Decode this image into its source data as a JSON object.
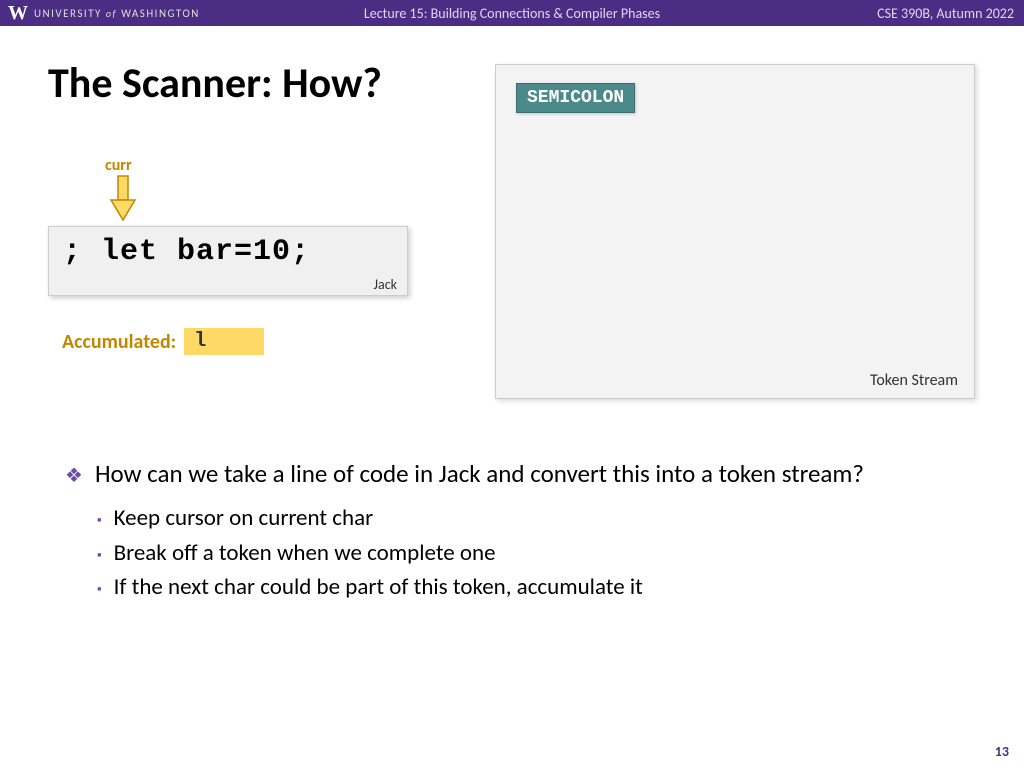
{
  "header": {
    "university_prefix": "UNIVERSITY",
    "university_of": "of",
    "university_name": "WASHINGTON",
    "lecture": "Lecture 15: Building Connections & Compiler Phases",
    "course": "CSE 390B, Autumn 2022"
  },
  "title": "The Scanner: How?",
  "cursor": {
    "label": "curr"
  },
  "code": {
    "text": "; let bar=10;",
    "language": "Jack"
  },
  "accumulated": {
    "label": "Accumulated:",
    "value": "l"
  },
  "token_stream": {
    "tokens": [
      "SEMICOLON"
    ],
    "label": "Token Stream"
  },
  "bullets": {
    "main": "How can we take a line of code in Jack and convert this into a token stream?",
    "subs": [
      "Keep cursor on current char",
      "Break off a token when we complete one",
      "If the next char could be part of this token, accumulate it"
    ]
  },
  "page_number": "13"
}
